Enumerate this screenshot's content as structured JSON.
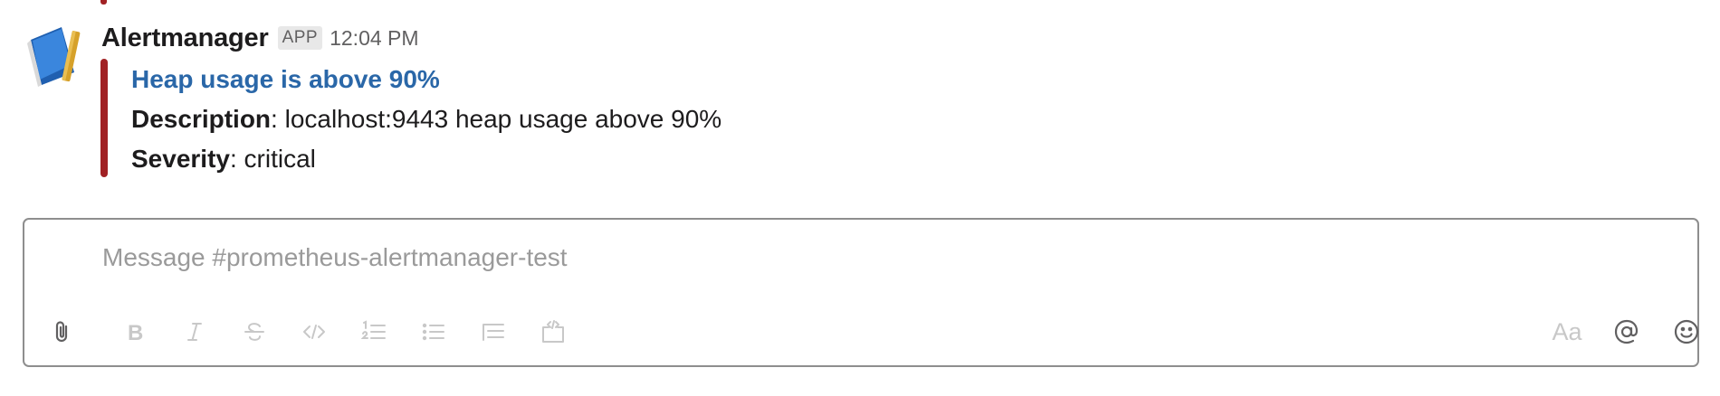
{
  "message": {
    "sender": "Alertmanager",
    "badge": "APP",
    "timestamp": "12:04 PM",
    "accent_color": "#a12124",
    "avatar_icon": "notebook-icon"
  },
  "attachment": {
    "title": "Heap usage is above 90%",
    "fields": [
      {
        "label": "Description",
        "separator": ": ",
        "value": "localhost:9443 heap usage above 90%"
      },
      {
        "label": "Severity",
        "separator": ": ",
        "value": "critical"
      }
    ]
  },
  "composer": {
    "placeholder": "Message #prometheus-alertmanager-test",
    "value": "",
    "format_label": "Aa",
    "icons": [
      "paperclip-icon",
      "bold-icon",
      "italic-icon",
      "strikethrough-icon",
      "code-icon",
      "numbered-list-icon",
      "bulleted-list-icon",
      "quote-icon",
      "code-block-icon",
      "format-icon",
      "mention-icon",
      "emoji-icon"
    ]
  }
}
